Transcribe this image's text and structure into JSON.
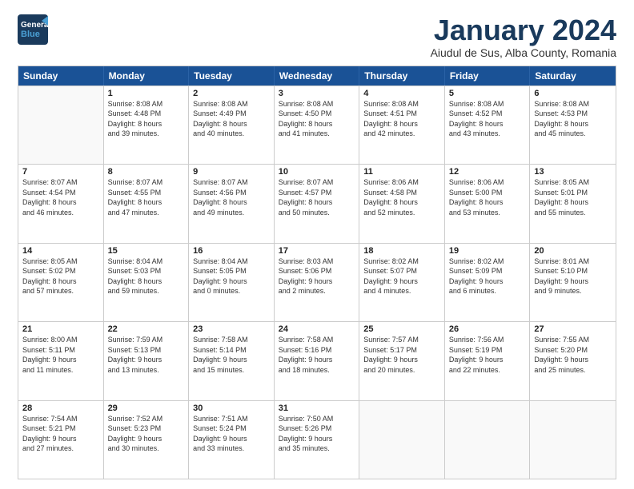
{
  "logo": {
    "line1": "General",
    "line2": "Blue"
  },
  "title": "January 2024",
  "subtitle": "Aiudul de Sus, Alba County, Romania",
  "days": [
    "Sunday",
    "Monday",
    "Tuesday",
    "Wednesday",
    "Thursday",
    "Friday",
    "Saturday"
  ],
  "weeks": [
    [
      {
        "day": "",
        "empty": true
      },
      {
        "day": "1",
        "sunrise": "8:08 AM",
        "sunset": "4:48 PM",
        "daylight": "8 hours and 39 minutes."
      },
      {
        "day": "2",
        "sunrise": "8:08 AM",
        "sunset": "4:49 PM",
        "daylight": "8 hours and 40 minutes."
      },
      {
        "day": "3",
        "sunrise": "8:08 AM",
        "sunset": "4:50 PM",
        "daylight": "8 hours and 41 minutes."
      },
      {
        "day": "4",
        "sunrise": "8:08 AM",
        "sunset": "4:51 PM",
        "daylight": "8 hours and 42 minutes."
      },
      {
        "day": "5",
        "sunrise": "8:08 AM",
        "sunset": "4:52 PM",
        "daylight": "8 hours and 43 minutes."
      },
      {
        "day": "6",
        "sunrise": "8:08 AM",
        "sunset": "4:53 PM",
        "daylight": "8 hours and 45 minutes."
      }
    ],
    [
      {
        "day": "7",
        "sunrise": "8:07 AM",
        "sunset": "4:54 PM",
        "daylight": "8 hours and 46 minutes."
      },
      {
        "day": "8",
        "sunrise": "8:07 AM",
        "sunset": "4:55 PM",
        "daylight": "8 hours and 47 minutes."
      },
      {
        "day": "9",
        "sunrise": "8:07 AM",
        "sunset": "4:56 PM",
        "daylight": "8 hours and 49 minutes."
      },
      {
        "day": "10",
        "sunrise": "8:07 AM",
        "sunset": "4:57 PM",
        "daylight": "8 hours and 50 minutes."
      },
      {
        "day": "11",
        "sunrise": "8:06 AM",
        "sunset": "4:58 PM",
        "daylight": "8 hours and 52 minutes."
      },
      {
        "day": "12",
        "sunrise": "8:06 AM",
        "sunset": "5:00 PM",
        "daylight": "8 hours and 53 minutes."
      },
      {
        "day": "13",
        "sunrise": "8:05 AM",
        "sunset": "5:01 PM",
        "daylight": "8 hours and 55 minutes."
      }
    ],
    [
      {
        "day": "14",
        "sunrise": "8:05 AM",
        "sunset": "5:02 PM",
        "daylight": "8 hours and 57 minutes."
      },
      {
        "day": "15",
        "sunrise": "8:04 AM",
        "sunset": "5:03 PM",
        "daylight": "8 hours and 59 minutes."
      },
      {
        "day": "16",
        "sunrise": "8:04 AM",
        "sunset": "5:05 PM",
        "daylight": "9 hours and 0 minutes."
      },
      {
        "day": "17",
        "sunrise": "8:03 AM",
        "sunset": "5:06 PM",
        "daylight": "9 hours and 2 minutes."
      },
      {
        "day": "18",
        "sunrise": "8:02 AM",
        "sunset": "5:07 PM",
        "daylight": "9 hours and 4 minutes."
      },
      {
        "day": "19",
        "sunrise": "8:02 AM",
        "sunset": "5:09 PM",
        "daylight": "9 hours and 6 minutes."
      },
      {
        "day": "20",
        "sunrise": "8:01 AM",
        "sunset": "5:10 PM",
        "daylight": "9 hours and 9 minutes."
      }
    ],
    [
      {
        "day": "21",
        "sunrise": "8:00 AM",
        "sunset": "5:11 PM",
        "daylight": "9 hours and 11 minutes."
      },
      {
        "day": "22",
        "sunrise": "7:59 AM",
        "sunset": "5:13 PM",
        "daylight": "9 hours and 13 minutes."
      },
      {
        "day": "23",
        "sunrise": "7:58 AM",
        "sunset": "5:14 PM",
        "daylight": "9 hours and 15 minutes."
      },
      {
        "day": "24",
        "sunrise": "7:58 AM",
        "sunset": "5:16 PM",
        "daylight": "9 hours and 18 minutes."
      },
      {
        "day": "25",
        "sunrise": "7:57 AM",
        "sunset": "5:17 PM",
        "daylight": "9 hours and 20 minutes."
      },
      {
        "day": "26",
        "sunrise": "7:56 AM",
        "sunset": "5:19 PM",
        "daylight": "9 hours and 22 minutes."
      },
      {
        "day": "27",
        "sunrise": "7:55 AM",
        "sunset": "5:20 PM",
        "daylight": "9 hours and 25 minutes."
      }
    ],
    [
      {
        "day": "28",
        "sunrise": "7:54 AM",
        "sunset": "5:21 PM",
        "daylight": "9 hours and 27 minutes."
      },
      {
        "day": "29",
        "sunrise": "7:52 AM",
        "sunset": "5:23 PM",
        "daylight": "9 hours and 30 minutes."
      },
      {
        "day": "30",
        "sunrise": "7:51 AM",
        "sunset": "5:24 PM",
        "daylight": "9 hours and 33 minutes."
      },
      {
        "day": "31",
        "sunrise": "7:50 AM",
        "sunset": "5:26 PM",
        "daylight": "9 hours and 35 minutes."
      },
      {
        "day": "",
        "empty": true
      },
      {
        "day": "",
        "empty": true
      },
      {
        "day": "",
        "empty": true
      }
    ]
  ]
}
